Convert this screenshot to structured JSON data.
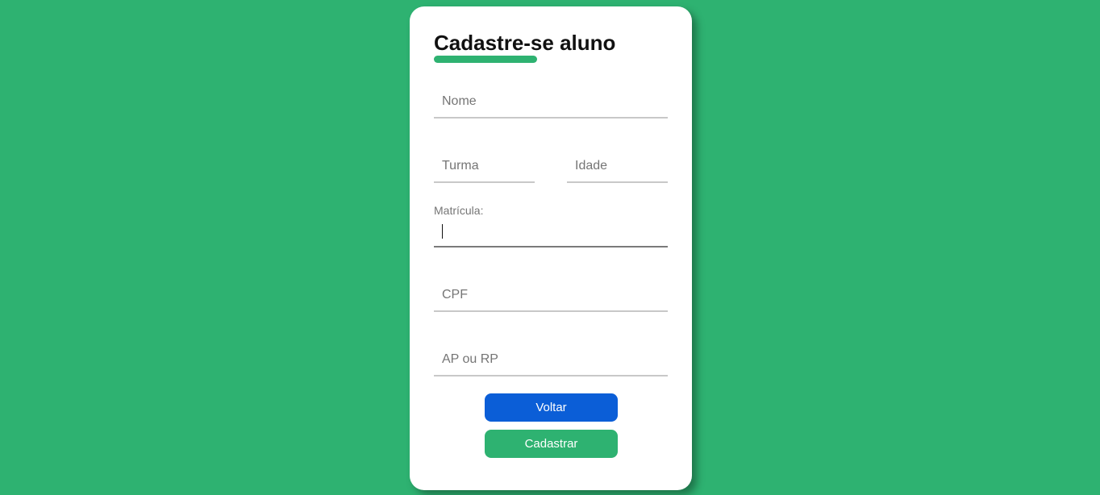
{
  "colors": {
    "background": "#2eb271",
    "accent": "#2eb271",
    "voltar_button": "#0b5ed7",
    "cadastrar_button": "#2eb271"
  },
  "form": {
    "title": "Cadastre-se aluno",
    "nome": {
      "placeholder": "Nome",
      "value": ""
    },
    "turma": {
      "placeholder": "Turma",
      "value": ""
    },
    "idade": {
      "placeholder": "Idade",
      "value": ""
    },
    "matricula": {
      "label": "Matrícula:",
      "value": ""
    },
    "cpf": {
      "placeholder": "CPF",
      "value": ""
    },
    "ap_rp": {
      "placeholder": "AP ou RP",
      "value": ""
    }
  },
  "buttons": {
    "voltar_label": "Voltar",
    "cadastrar_label": "Cadastrar"
  }
}
